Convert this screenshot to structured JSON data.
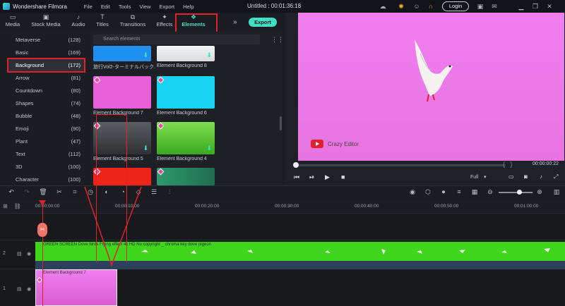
{
  "titlebar": {
    "app_name": "Wondershare Filmora",
    "menus": [
      "File",
      "Edit",
      "Tools",
      "View",
      "Export",
      "Help"
    ],
    "project_title": "Untitled : 00:01:36:18",
    "login_label": "Login"
  },
  "tabs": [
    {
      "label": "Media",
      "icon": "folder-icon"
    },
    {
      "label": "Stock Media",
      "icon": "stock-media-icon"
    },
    {
      "label": "Audio",
      "icon": "music-note-icon"
    },
    {
      "label": "Titles",
      "icon": "text-t-icon"
    },
    {
      "label": "Transitions",
      "icon": "transitions-icon"
    },
    {
      "label": "Effects",
      "icon": "effects-icon"
    },
    {
      "label": "Elements",
      "icon": "elements-icon",
      "active": true
    }
  ],
  "export_label": "Export",
  "categories": [
    {
      "label": "Metaverse",
      "count": "(128)"
    },
    {
      "label": "Basic",
      "count": "(169)"
    },
    {
      "label": "Background",
      "count": "(172)",
      "active": true
    },
    {
      "label": "Arrow",
      "count": "(81)"
    },
    {
      "label": "Countdown",
      "count": "(80)"
    },
    {
      "label": "Shapes",
      "count": "(74)"
    },
    {
      "label": "Bubble",
      "count": "(48)"
    },
    {
      "label": "Emoji",
      "count": "(90)"
    },
    {
      "label": "Plant",
      "count": "(47)"
    },
    {
      "label": "Text",
      "count": "(112)"
    },
    {
      "label": "3D",
      "count": "(100)"
    },
    {
      "label": "Character",
      "count": "(100)"
    }
  ],
  "search": {
    "placeholder": "Search elements"
  },
  "library_items": [
    {
      "label": "旅行Vol2-ターミナルバック...",
      "color": "#1e90f0"
    },
    {
      "label": "Element Background 8",
      "color": "#e8eaec"
    },
    {
      "label": "Element Background 7",
      "color": "#e760d8"
    },
    {
      "label": "Element Background 6",
      "color": "#18d4f0"
    },
    {
      "label": "Element Background 5",
      "color": "#4a4d52"
    },
    {
      "label": "Element Background 4",
      "color": "#5cd632"
    },
    {
      "label": "",
      "color": "#ee2418"
    },
    {
      "label": "",
      "color": "#2c9a6e"
    }
  ],
  "preview": {
    "brand_text": "Crazy Editor",
    "time": "00:00:00:22",
    "quality": "Full",
    "bg_color": "#ee7ae9"
  },
  "ruler_labels": [
    "00:00:00:00",
    "00:00:10:00",
    "00:00:20:00",
    "00:00:30:00",
    "00:00:40:00",
    "00:00:50:00",
    "00:01:00:00"
  ],
  "timeline": {
    "green_clip_label": "GREEN SCREEN Dove birds Flying effect 4k HD No copyright _ chroma key dove pigeon",
    "pink_clip_label": "Element Background 7",
    "track2_label": "2",
    "track1_label": "1"
  }
}
